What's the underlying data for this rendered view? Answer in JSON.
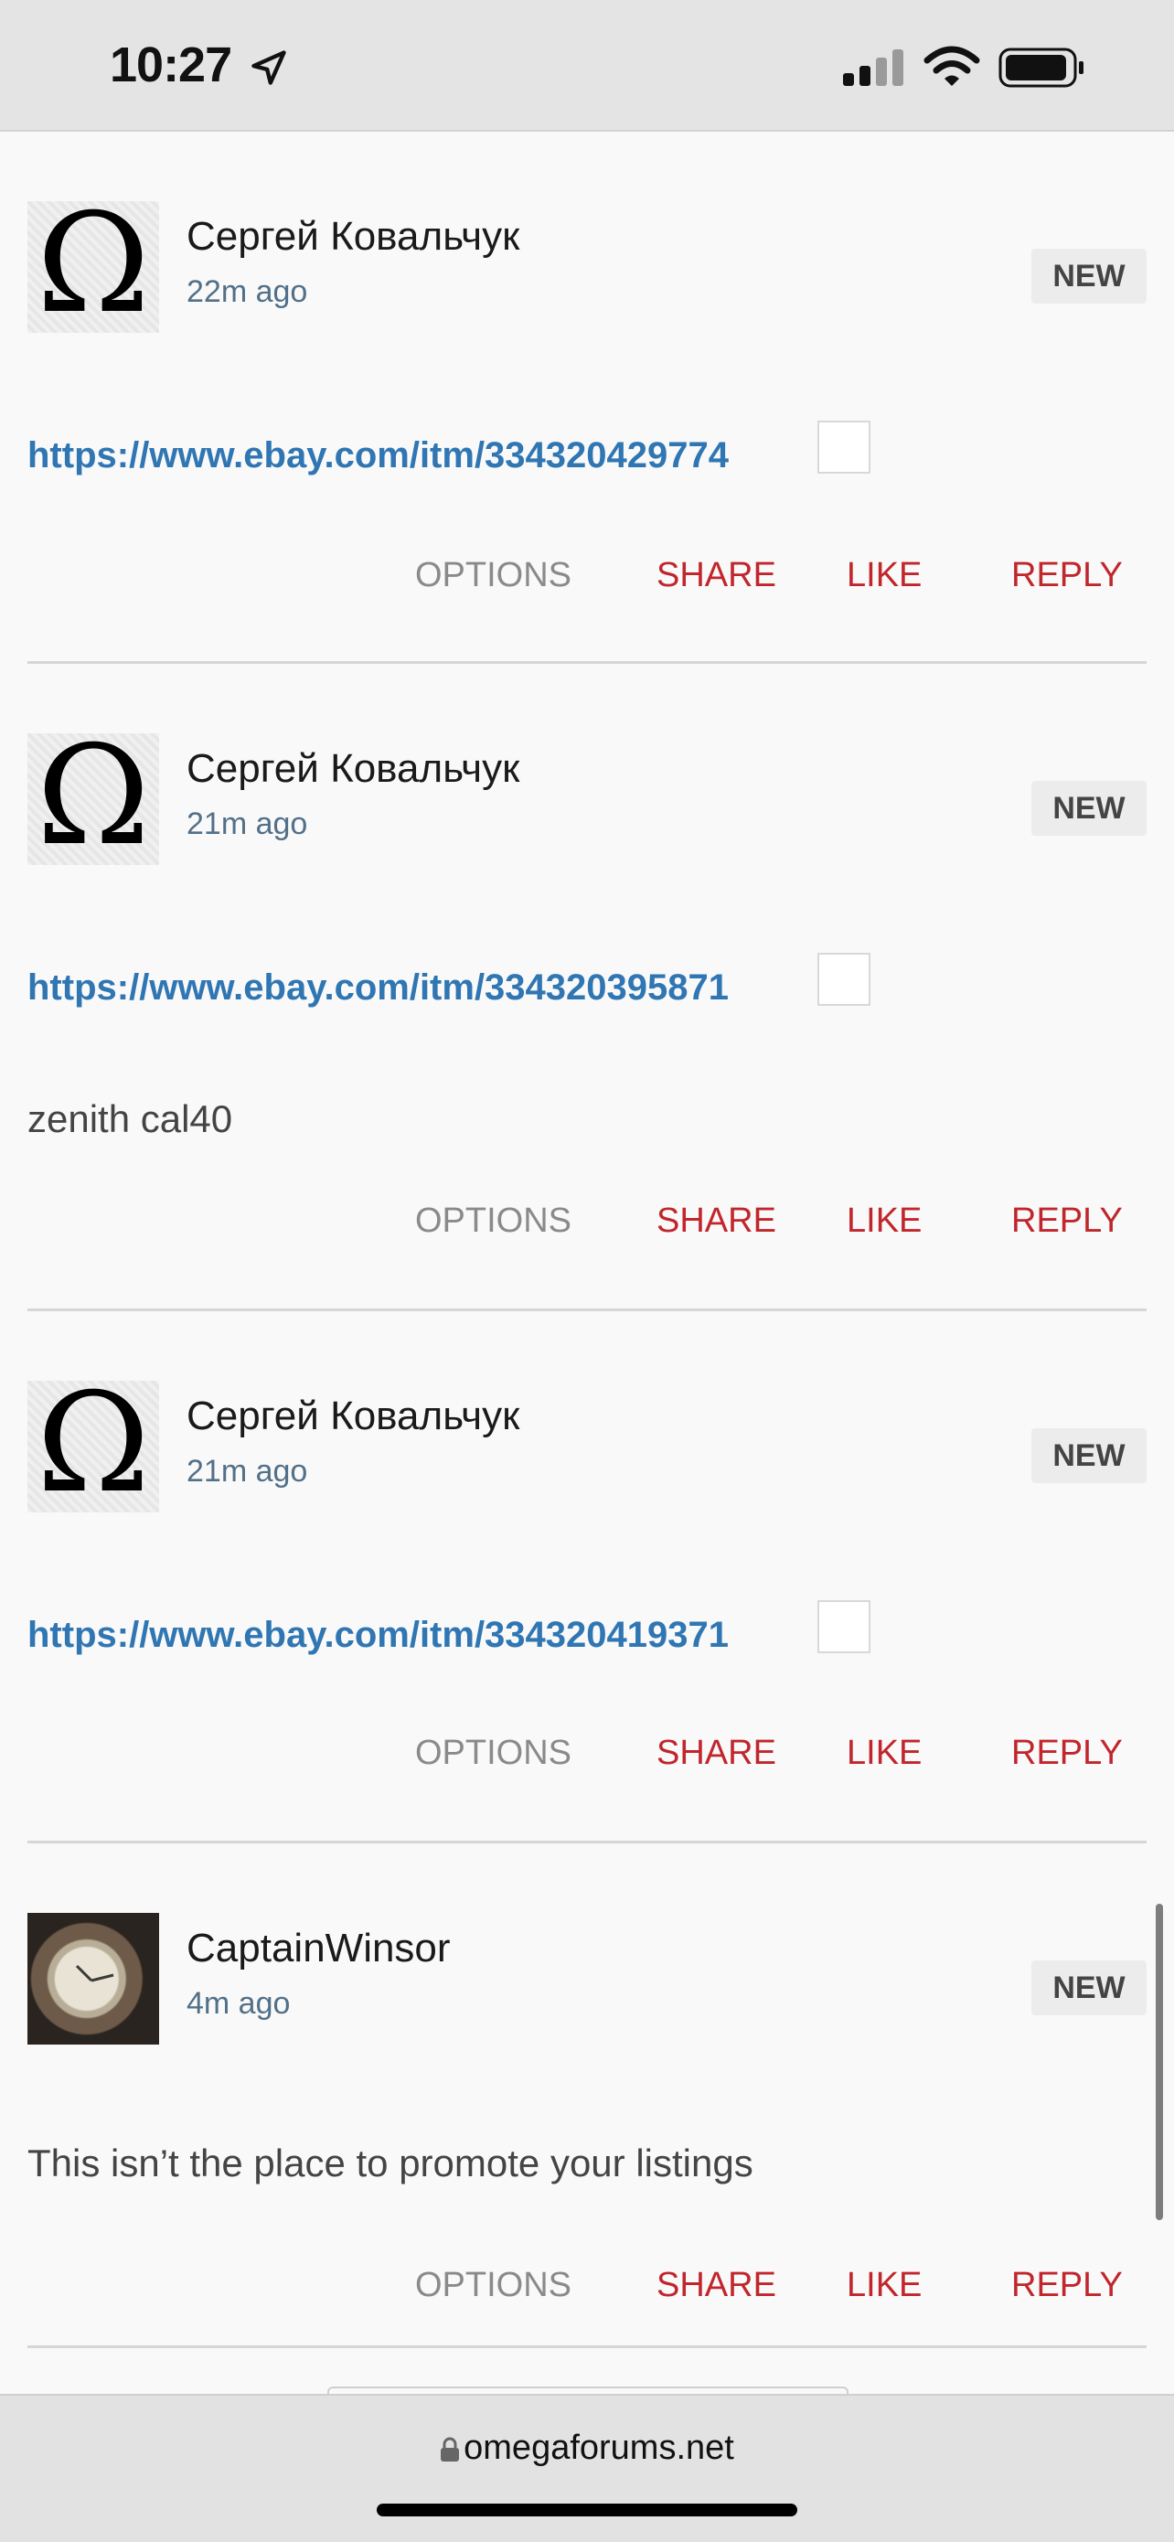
{
  "status_bar": {
    "time": "10:27"
  },
  "posts": [
    {
      "author": "Сергей Ковальчук",
      "time_ago": "22m ago",
      "badge": "NEW",
      "link": "https://www.ebay.com/itm/334320429774",
      "text": "",
      "actions": {
        "options": "OPTIONS",
        "share": "SHARE",
        "like": "LIKE",
        "reply": "REPLY"
      }
    },
    {
      "author": "Сергей Ковальчук",
      "time_ago": "21m ago",
      "badge": "NEW",
      "link": "https://www.ebay.com/itm/334320395871",
      "text": "zenith cal40",
      "actions": {
        "options": "OPTIONS",
        "share": "SHARE",
        "like": "LIKE",
        "reply": "REPLY"
      }
    },
    {
      "author": "Сергей Ковальчук",
      "time_ago": "21m ago",
      "badge": "NEW",
      "link": "https://www.ebay.com/itm/334320419371",
      "text": "",
      "actions": {
        "options": "OPTIONS",
        "share": "SHARE",
        "like": "LIKE",
        "reply": "REPLY"
      }
    },
    {
      "author": "CaptainWinsor",
      "time_ago": "4m ago",
      "badge": "NEW",
      "link": "",
      "text": "This isn’t the place to promote your listings",
      "actions": {
        "options": "OPTIONS",
        "share": "SHARE",
        "like": "LIKE",
        "reply": "REPLY"
      }
    }
  ],
  "browser": {
    "url": "omegaforums.net"
  }
}
